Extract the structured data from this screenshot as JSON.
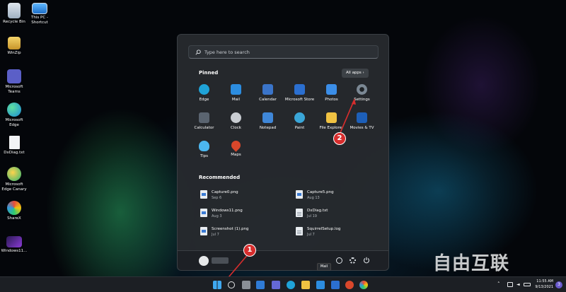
{
  "desktop": {
    "icons": [
      {
        "label": "Recycle Bin"
      },
      {
        "label": "This PC - Shortcut"
      },
      {
        "label": "WinZip"
      },
      {
        "label": "Microsoft Teams"
      },
      {
        "label": "Microsoft Edge"
      },
      {
        "label": "DxDiag.txt"
      },
      {
        "label": "Microsoft Edge Canary"
      },
      {
        "label": "ShareX"
      },
      {
        "label": "Windows11..."
      }
    ]
  },
  "start_menu": {
    "search_placeholder": "Type here to search",
    "pinned_title": "Pinned",
    "all_apps_label": "All apps",
    "pinned": [
      {
        "label": "Edge",
        "color": "#1fa3d8"
      },
      {
        "label": "Mail",
        "color": "#2c8de0"
      },
      {
        "label": "Calendar",
        "color": "#3a74c9"
      },
      {
        "label": "Microsoft Store",
        "color": "#2b6fd0"
      },
      {
        "label": "Photos",
        "color": "#3b8ee8"
      },
      {
        "label": "Settings",
        "color": "#7b8894"
      },
      {
        "label": "Calculator",
        "color": "#5a6470"
      },
      {
        "label": "Clock",
        "color": "#c9cdd2"
      },
      {
        "label": "Notepad",
        "color": "#3f87d8"
      },
      {
        "label": "Paint",
        "color": "#3aa6d8"
      },
      {
        "label": "File Explorer",
        "color": "#f0c242"
      },
      {
        "label": "Movies & TV",
        "color": "#1d5fb8"
      },
      {
        "label": "Tips",
        "color": "#4cb7f0"
      },
      {
        "label": "Maps",
        "color": "#d9472b"
      }
    ],
    "recommended_title": "Recommended",
    "recommended": [
      {
        "name": "Capture0.png",
        "date": "Sep 6",
        "kind": "img"
      },
      {
        "name": "Capture5.png",
        "date": "Aug 13",
        "kind": "img"
      },
      {
        "name": "Windows11.png",
        "date": "Aug 3",
        "kind": "img"
      },
      {
        "name": "DxDiag.txt",
        "date": "Jul 19",
        "kind": "txt"
      },
      {
        "name": "Screenshot (1).png",
        "date": "Jul 7",
        "kind": "img"
      },
      {
        "name": "SquirrelSetup.log",
        "date": "Jul 7",
        "kind": "txt"
      }
    ]
  },
  "taskbar": {
    "tooltip": "Mail",
    "time": "11:55 AM",
    "date": "9/13/2021",
    "notification_count": "3"
  },
  "annotations": {
    "step1": "1",
    "step2": "2"
  },
  "watermark": "自由互联"
}
